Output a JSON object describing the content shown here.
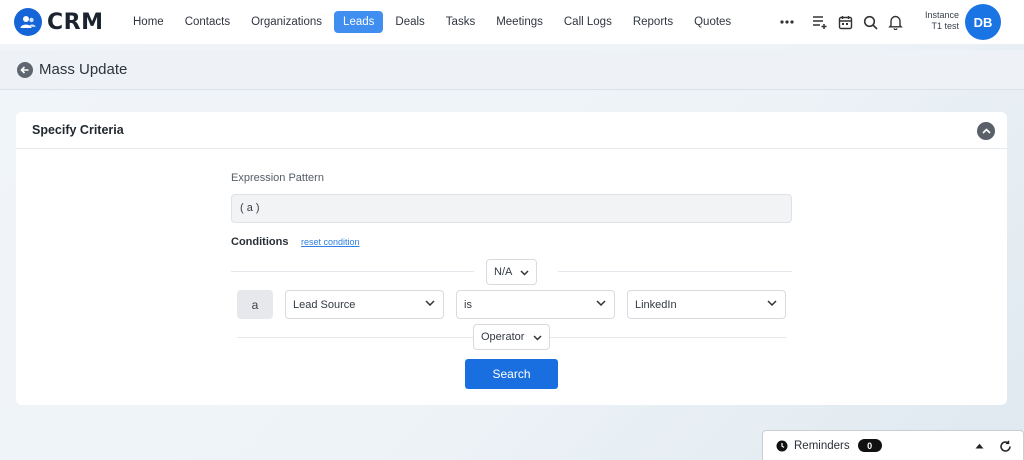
{
  "app": {
    "name": "CRM"
  },
  "nav": {
    "items": [
      {
        "label": "Home"
      },
      {
        "label": "Contacts"
      },
      {
        "label": "Organizations"
      },
      {
        "label": "Leads",
        "active": true
      },
      {
        "label": "Deals"
      },
      {
        "label": "Tasks"
      },
      {
        "label": "Meetings"
      },
      {
        "label": "Call Logs"
      },
      {
        "label": "Reports"
      },
      {
        "label": "Quotes"
      }
    ],
    "more_label": "•••"
  },
  "user": {
    "line1": "Instance",
    "line2": "T1 test",
    "initials": "DB"
  },
  "page": {
    "title": "Mass Update"
  },
  "criteria": {
    "title": "Specify Criteria",
    "expression_label": "Expression Pattern",
    "expression_value": "( a )",
    "conditions_label": "Conditions",
    "reset_label": "reset condition",
    "group_operator": "N/A",
    "row": {
      "tag": "a",
      "field": "Lead Source",
      "comparator": "is",
      "value": "LinkedIn"
    },
    "operator_label": "Operator",
    "search_label": "Search"
  },
  "reminders": {
    "label": "Reminders",
    "count": "0"
  },
  "colors": {
    "accent": "#1a6fe0",
    "active_nav": "#3f8ef0",
    "avatar": "#1b74e4"
  },
  "icons": [
    "crm-logo-icon",
    "more-dots-icon",
    "add-list-icon",
    "calendar-icon",
    "search-icon",
    "bell-icon",
    "back-arrow-icon",
    "collapse-chevron-icon",
    "chevron-down-icon",
    "clock-icon",
    "caret-up-icon",
    "refresh-icon"
  ]
}
